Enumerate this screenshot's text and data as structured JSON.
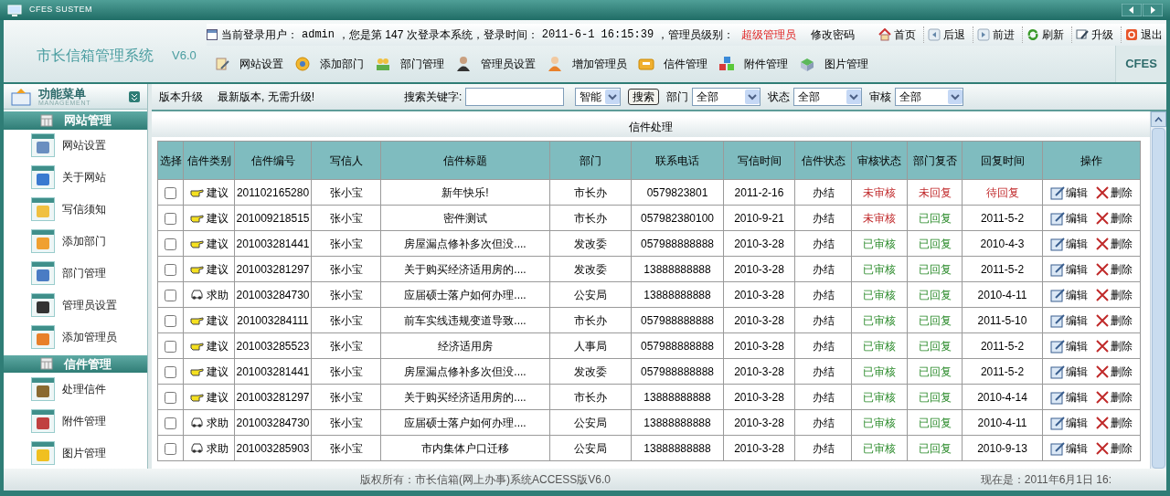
{
  "window": {
    "title": "CFES SUSTEM"
  },
  "logo": {
    "name": "市长信箱管理系统",
    "version": "V6.0",
    "brand": "CFES"
  },
  "login_info": {
    "prefix": "当前登录用户：",
    "user": "admin",
    "count_text": "，您是第 147 次登录本系统，登录时间：",
    "time": "2011-6-1 16:15:39",
    "level_label": "，管理员级别：",
    "level": "超级管理员",
    "change_password": "修改密码"
  },
  "top_links": [
    "首页",
    "后退",
    "前进",
    "刷新",
    "升级",
    "退出"
  ],
  "toolbar": [
    "网站设置",
    "添加部门",
    "部门管理",
    "管理员设置",
    "增加管理员",
    "信件管理",
    "附件管理",
    "图片管理"
  ],
  "sidebar": {
    "title": "功能菜单",
    "subtitle": "MANAGEMENT",
    "sections": [
      {
        "title": "网站管理",
        "items": [
          "网站设置",
          "关于网站",
          "写信须知",
          "添加部门",
          "部门管理",
          "管理员设置",
          "添加管理员"
        ]
      },
      {
        "title": "信件管理",
        "items": [
          "处理信件",
          "附件管理",
          "图片管理"
        ]
      }
    ]
  },
  "upgrade": {
    "label": "版本升级",
    "message": "最新版本, 无需升级!"
  },
  "search": {
    "label": "搜索关键字:",
    "mode": "智能",
    "button": "搜索",
    "filters": [
      {
        "label": "部门",
        "value": "全部"
      },
      {
        "label": "状态",
        "value": "全部"
      },
      {
        "label": "审核",
        "value": "全部"
      }
    ]
  },
  "panel_title": "信件处理",
  "table": {
    "columns": [
      "选择",
      "信件类别",
      "信件编号",
      "写信人",
      "信件标题",
      "部门",
      "联系电话",
      "写信时间",
      "信件状态",
      "审核状态",
      "部门复否",
      "回复时间",
      "操作"
    ],
    "rows": [
      {
        "checked": false,
        "kind": "suggest",
        "category": "建议",
        "number": "201102165280",
        "writer": "张小宝",
        "title": "新年快乐!",
        "dept": "市长办",
        "phone": "0579823801",
        "date": "2011-2-16",
        "status": "办结",
        "reviewed": false,
        "review": "未审核",
        "replied": false,
        "reply": "未回复",
        "reply_time": "待回复",
        "actions": [
          "编辑",
          "删除"
        ]
      },
      {
        "checked": false,
        "kind": "suggest",
        "category": "建议",
        "number": "201009218515",
        "writer": "张小宝",
        "title": "密件测试",
        "dept": "市长办",
        "phone": "057982380100",
        "date": "2010-9-21",
        "status": "办结",
        "reviewed": false,
        "review": "未审核",
        "replied": true,
        "reply": "已回复",
        "reply_time": "2011-5-2",
        "actions": [
          "编辑",
          "删除"
        ]
      },
      {
        "checked": false,
        "kind": "suggest",
        "category": "建议",
        "number": "201003281441",
        "writer": "张小宝",
        "title": "房屋漏点修补多次但没....",
        "dept": "发改委",
        "phone": "057988888888",
        "date": "2010-3-28",
        "status": "办结",
        "reviewed": true,
        "review": "已审核",
        "replied": true,
        "reply": "已回复",
        "reply_time": "2010-4-3",
        "actions": [
          "编辑",
          "删除"
        ]
      },
      {
        "checked": false,
        "kind": "suggest",
        "category": "建议",
        "number": "201003281297",
        "writer": "张小宝",
        "title": "关于购买经济适用房的....",
        "dept": "发改委",
        "phone": "13888888888",
        "date": "2010-3-28",
        "status": "办结",
        "reviewed": true,
        "review": "已审核",
        "replied": true,
        "reply": "已回复",
        "reply_time": "2011-5-2",
        "actions": [
          "编辑",
          "删除"
        ]
      },
      {
        "checked": false,
        "kind": "help",
        "category": "求助",
        "number": "201003284730",
        "writer": "张小宝",
        "title": "应届硕士落户如何办理....",
        "dept": "公安局",
        "phone": "13888888888",
        "date": "2010-3-28",
        "status": "办结",
        "reviewed": true,
        "review": "已审核",
        "replied": true,
        "reply": "已回复",
        "reply_time": "2010-4-11",
        "actions": [
          "编辑",
          "删除"
        ]
      },
      {
        "checked": false,
        "kind": "suggest",
        "category": "建议",
        "number": "201003284111",
        "writer": "张小宝",
        "title": "前车实线违规变道导致....",
        "dept": "市长办",
        "phone": "057988888888",
        "date": "2010-3-28",
        "status": "办结",
        "reviewed": true,
        "review": "已审核",
        "replied": true,
        "reply": "已回复",
        "reply_time": "2011-5-10",
        "actions": [
          "编辑",
          "删除"
        ]
      },
      {
        "checked": false,
        "kind": "suggest",
        "category": "建议",
        "number": "201003285523",
        "writer": "张小宝",
        "title": "经济适用房",
        "dept": "人事局",
        "phone": "057988888888",
        "date": "2010-3-28",
        "status": "办结",
        "reviewed": true,
        "review": "已审核",
        "replied": true,
        "reply": "已回复",
        "reply_time": "2011-5-2",
        "actions": [
          "编辑",
          "删除"
        ]
      },
      {
        "checked": false,
        "kind": "suggest",
        "category": "建议",
        "number": "201003281441",
        "writer": "张小宝",
        "title": "房屋漏点修补多次但没....",
        "dept": "发改委",
        "phone": "057988888888",
        "date": "2010-3-28",
        "status": "办结",
        "reviewed": true,
        "review": "已审核",
        "replied": true,
        "reply": "已回复",
        "reply_time": "2011-5-2",
        "actions": [
          "编辑",
          "删除"
        ]
      },
      {
        "checked": false,
        "kind": "suggest",
        "category": "建议",
        "number": "201003281297",
        "writer": "张小宝",
        "title": "关于购买经济适用房的....",
        "dept": "市长办",
        "phone": "13888888888",
        "date": "2010-3-28",
        "status": "办结",
        "reviewed": true,
        "review": "已审核",
        "replied": true,
        "reply": "已回复",
        "reply_time": "2010-4-14",
        "actions": [
          "编辑",
          "删除"
        ]
      },
      {
        "checked": false,
        "kind": "help",
        "category": "求助",
        "number": "201003284730",
        "writer": "张小宝",
        "title": "应届硕士落户如何办理....",
        "dept": "公安局",
        "phone": "13888888888",
        "date": "2010-3-28",
        "status": "办结",
        "reviewed": true,
        "review": "已审核",
        "replied": true,
        "reply": "已回复",
        "reply_time": "2010-4-11",
        "actions": [
          "编辑",
          "删除"
        ]
      },
      {
        "checked": false,
        "kind": "help",
        "category": "求助",
        "number": "201003285903",
        "writer": "张小宝",
        "title": "市内集体户口迁移",
        "dept": "公安局",
        "phone": "13888888888",
        "date": "2010-3-28",
        "status": "办结",
        "reviewed": true,
        "review": "已审核",
        "replied": true,
        "reply": "已回复",
        "reply_time": "2010-9-13",
        "actions": [
          "编辑",
          "删除"
        ]
      }
    ]
  },
  "footer": {
    "copyright": "版权所有：市长信箱(网上办事)系统ACCESS版V6.0",
    "now": "现在是：2011年6月1日 16:"
  }
}
